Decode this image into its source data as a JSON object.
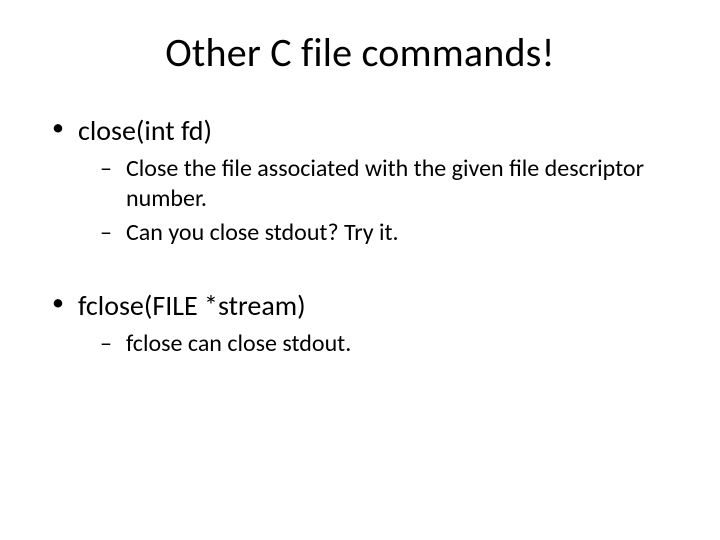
{
  "title": "Other C file commands!",
  "items": [
    {
      "text": "close(int fd)",
      "sub": [
        "Close the file associated with the given file descriptor number.",
        "Can you close stdout? Try it."
      ]
    },
    {
      "text": "fclose(FILE *stream)",
      "sub": [
        "fclose can close stdout."
      ]
    }
  ]
}
